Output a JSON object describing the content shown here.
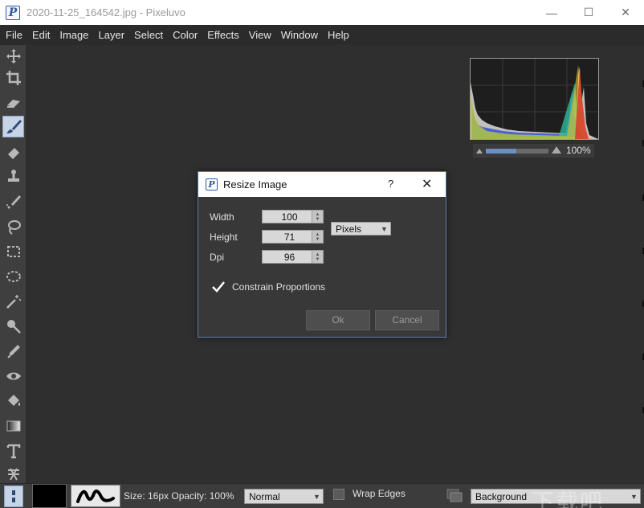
{
  "window": {
    "title": "2020-11-25_164542.jpg - Pixeluvo",
    "logo_letter": "P",
    "minimize": "—",
    "maximize": "☐",
    "close": "✕"
  },
  "menu": [
    "File",
    "Edit",
    "Image",
    "Layer",
    "Select",
    "Color",
    "Effects",
    "View",
    "Window",
    "Help"
  ],
  "tools": [
    "move-icon",
    "crop-icon",
    "eraser-smudge-icon",
    "brush-icon",
    "eraser-icon",
    "clone-stamp-icon",
    "pencil-icon",
    "lasso-icon",
    "rect-select-icon",
    "ellipse-select-icon",
    "magic-wand-icon",
    "dodge-icon",
    "color-pick-icon",
    "eye-icon",
    "fill-bucket-icon",
    "gradient-icon",
    "text-icon",
    "shape-icon"
  ],
  "histogram": {
    "zoom": "100%"
  },
  "dialog": {
    "title": "Resize Image",
    "logo_letter": "P",
    "help": "?",
    "close": "✕",
    "width_label": "Width",
    "width_value": "100",
    "height_label": "Height",
    "height_value": "71",
    "dpi_label": "Dpi",
    "dpi_value": "96",
    "unit": "Pixels",
    "constrain_label": "Constrain Proportions",
    "constrain_checked": true,
    "ok": "Ok",
    "cancel": "Cancel"
  },
  "status": {
    "size_opacity": "Size: 16px  Opacity: 100%",
    "blend_mode": "Normal",
    "wrap_edges": "Wrap Edges",
    "layer": "Background"
  },
  "watermark": "下载吧"
}
